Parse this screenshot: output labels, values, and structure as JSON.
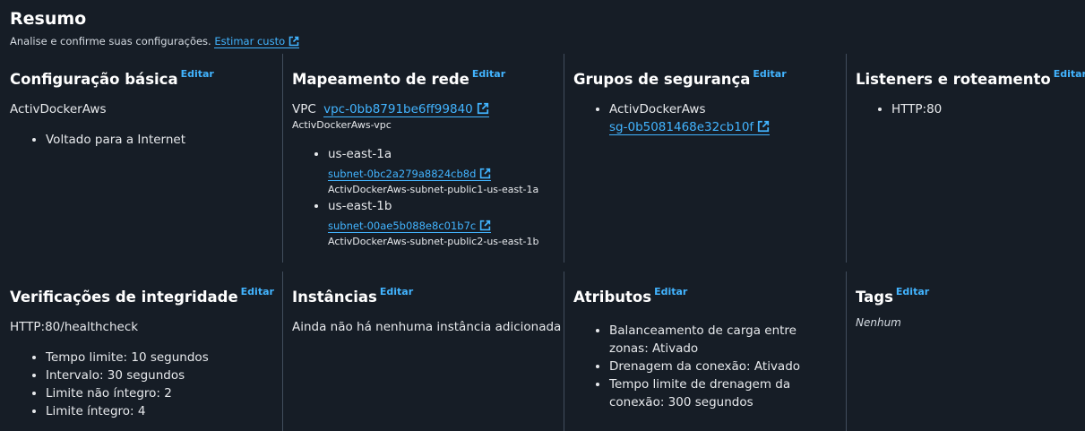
{
  "header": {
    "title": "Resumo",
    "subtitle": "Analise e confirme suas configurações.",
    "estimate_link": "Estimar custo"
  },
  "edit_label": "Editar",
  "basic": {
    "title": "Configuração básica",
    "name": "ActivDockerAws",
    "items": [
      "Voltado para a Internet"
    ]
  },
  "network": {
    "title": "Mapeamento de rede",
    "vpc_label": "VPC",
    "vpc_id": "vpc-0bb8791be6ff99840",
    "vpc_name": "ActivDockerAws-vpc",
    "zones": [
      {
        "az": "us-east-1a",
        "subnet_id": "subnet-0bc2a279a8824cb8d",
        "subnet_name": "ActivDockerAws-subnet-public1-us-east-1a"
      },
      {
        "az": "us-east-1b",
        "subnet_id": "subnet-00ae5b088e8c01b7c",
        "subnet_name": "ActivDockerAws-subnet-public2-us-east-1b"
      }
    ]
  },
  "security": {
    "title": "Grupos de segurança",
    "group_name": "ActivDockerAws",
    "group_id": "sg-0b5081468e32cb10f"
  },
  "listeners": {
    "title": "Listeners e roteamento",
    "items": [
      "HTTP:80"
    ]
  },
  "health": {
    "title": "Verificações de integridade",
    "path": "HTTP:80/healthcheck",
    "items": [
      "Tempo limite: 10 segundos",
      "Intervalo: 30 segundos",
      "Limite não íntegro: 2",
      "Limite íntegro: 4"
    ]
  },
  "instances": {
    "title": "Instâncias",
    "text": "Ainda não há nenhuma instância adicionada"
  },
  "attributes": {
    "title": "Atributos",
    "items": [
      "Balanceamento de carga entre zonas: Ativado",
      "Drenagem da conexão: Ativado",
      "Tempo limite de drenagem da conexão: 300 segundos"
    ]
  },
  "tags": {
    "title": "Tags",
    "value": "Nenhum"
  },
  "colors": {
    "background": "#161d26",
    "link": "#42b4ff",
    "divider": "#414d5c"
  }
}
